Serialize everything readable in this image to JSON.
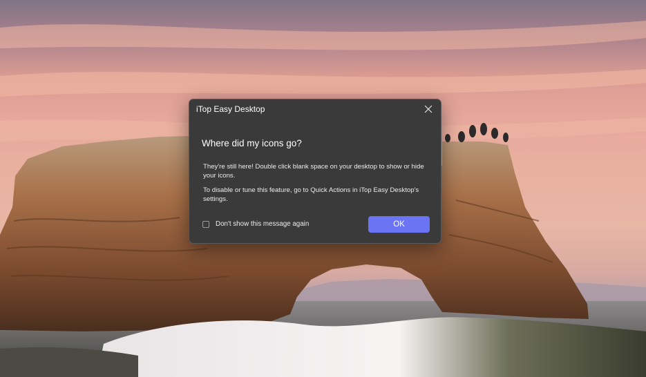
{
  "dialog": {
    "title": "iTop Easy Desktop",
    "heading": "Where did my icons go?",
    "paragraphs": [
      "They're still here! Double click blank space on your desktop to show or hide your icons.",
      "To disable or tune this feature, go to Quick Actions in iTop Easy Desktop's settings."
    ],
    "checkbox_label": "Don't show this message again",
    "checkbox_checked": false,
    "ok_label": "OK"
  },
  "icons": {
    "close": "close-icon"
  },
  "colors": {
    "dialog_background": "#3a3a3a",
    "primary_button": "#6b74f2"
  }
}
